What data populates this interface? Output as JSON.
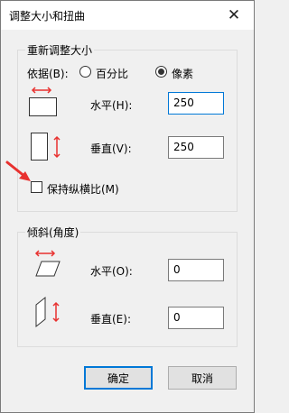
{
  "window": {
    "title": "调整大小和扭曲",
    "close_glyph": "✕"
  },
  "resize": {
    "group_title": "重新调整大小",
    "basis_label": "依据(B):",
    "option_percent": "百分比",
    "option_pixels": "像素",
    "selected": "像素",
    "horizontal_label": "水平(H):",
    "horizontal_value": "250",
    "vertical_label": "垂直(V):",
    "vertical_value": "250",
    "keep_ratio_label": "保持纵横比(M)",
    "keep_ratio_checked": false
  },
  "skew": {
    "group_title": "倾斜(角度)",
    "horizontal_label": "水平(O):",
    "horizontal_value": "0",
    "vertical_label": "垂直(E):",
    "vertical_value": "0"
  },
  "buttons": {
    "ok": "确定",
    "cancel": "取消"
  },
  "colors": {
    "accent": "#0078d7",
    "annotation_arrow": "#e8312f",
    "icon_arrow": "#e8312f"
  }
}
